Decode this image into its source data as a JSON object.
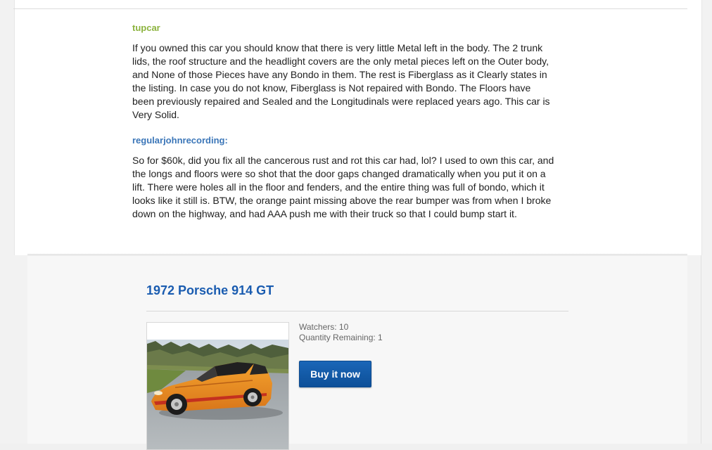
{
  "comments": [
    {
      "author": "tupcar",
      "text": "If you owned this car you should know that there is very little Metal left in the body. The 2 trunk lids, the roof structure and the headlight covers are the only metal pieces left on the Outer body, and None of those Pieces have any Bondo in them. The rest is Fiberglass as it Clearly states in the listing. In case you do not know, Fiberglass is Not repaired with Bondo. The Floors have been previously repaired and Sealed and the Longitudinals were replaced years ago. This car is Very Solid."
    },
    {
      "author": "regularjohnrecording:",
      "text": "So for $60k, did you fix all the cancerous rust and rot this car had, lol? I used to own this car, and the longs and floors were so shot that the door gaps changed dramatically when you put it on a lift. There were holes all in the floor and fenders, and the entire thing was full of bondo, which it looks like it still is. BTW, the orange paint missing above the rear bumper was from when I broke down on the highway, and had AAA push me with their truck so that I could bump start it."
    }
  ],
  "listing": {
    "title": "1972 Porsche 914 GT",
    "watchers": "Watchers: 10",
    "quantity": "Quantity Remaining: 1",
    "buy_label": "Buy it now",
    "photo_subject": "orange 1972 Porsche 914 on a driveway"
  },
  "colors": {
    "author_green": "#8cb33e",
    "author_blue": "#3b76b8",
    "title_blue": "#1a5cb0",
    "button_blue": "#0d4f98",
    "car_orange": "#e8891c"
  }
}
